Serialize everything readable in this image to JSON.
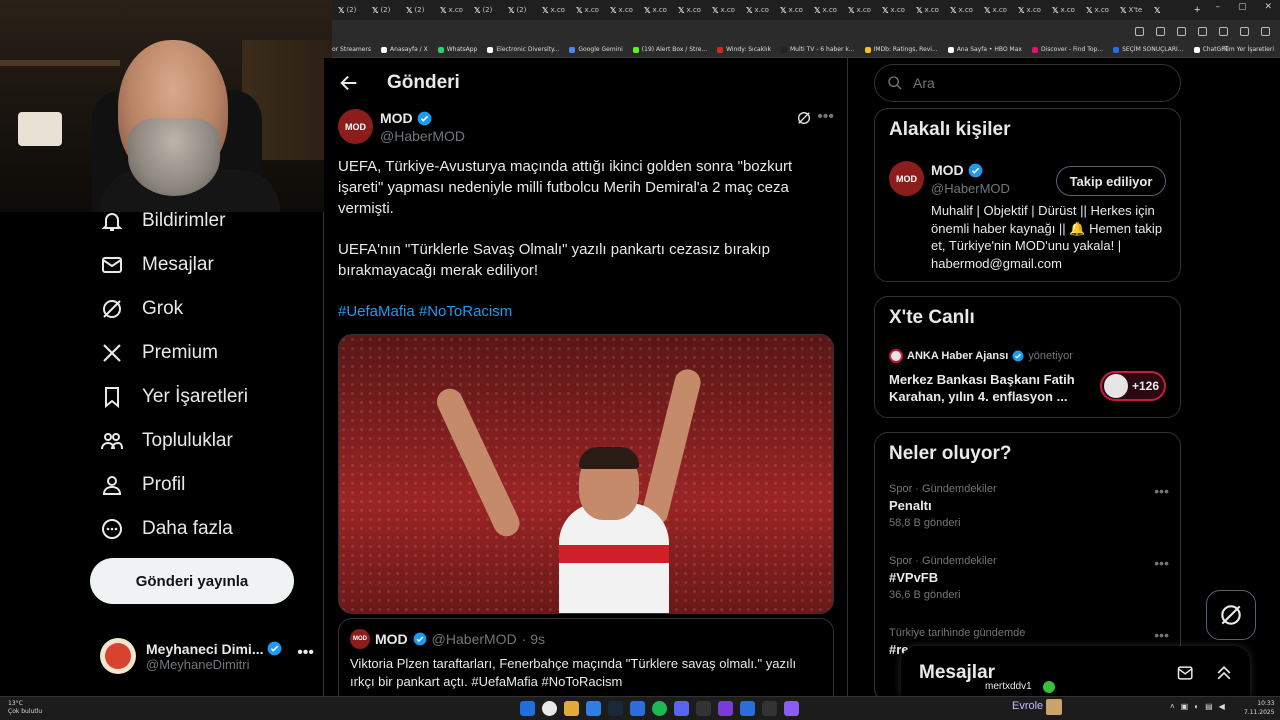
{
  "browser": {
    "tabs": [
      {
        "icon": "x-logo",
        "label": "(2)"
      },
      {
        "icon": "x-logo",
        "label": "(2)"
      },
      {
        "icon": "x-logo",
        "label": "(2)"
      },
      {
        "icon": "x-logo",
        "label": "x.co"
      },
      {
        "icon": "x-logo",
        "label": "(2)"
      },
      {
        "icon": "x-logo",
        "label": "(2)"
      },
      {
        "icon": "x-logo",
        "label": "x.co"
      },
      {
        "icon": "x-logo",
        "label": "x.co"
      },
      {
        "icon": "x-logo",
        "label": "x.co"
      },
      {
        "icon": "x-logo",
        "label": "x.co"
      },
      {
        "icon": "x-logo",
        "label": "x.co"
      },
      {
        "icon": "x-logo",
        "label": "x.co"
      },
      {
        "icon": "x-logo",
        "label": "x.co"
      },
      {
        "icon": "x-logo",
        "label": "x.co"
      },
      {
        "icon": "x-logo",
        "label": "x.co"
      },
      {
        "icon": "x-logo",
        "label": "x.co"
      },
      {
        "icon": "x-logo",
        "label": "x.co"
      },
      {
        "icon": "x-logo",
        "label": "x.co"
      },
      {
        "icon": "x-logo",
        "label": "x.co"
      },
      {
        "icon": "x-logo",
        "label": "x.co"
      },
      {
        "icon": "x-logo",
        "label": "x.co"
      },
      {
        "icon": "x-logo",
        "label": "x.co"
      },
      {
        "icon": "x-logo",
        "label": "x.co"
      },
      {
        "icon": "x-logo",
        "label": "X'te"
      },
      {
        "icon": "x-logo",
        "label": ""
      }
    ],
    "bookmarks": [
      {
        "label": "or Streamers",
        "color": ""
      },
      {
        "label": "Anasayfa / X",
        "color": "#ffffff"
      },
      {
        "label": "WhatsApp",
        "color": "#25d366"
      },
      {
        "label": "Electronic Diversity...",
        "color": "#ffffff"
      },
      {
        "label": "Google Gemini",
        "color": "#4f86f7"
      },
      {
        "label": "(19) Alert Box / Stre...",
        "color": "#53fc18"
      },
      {
        "label": "Windy: Sıcaklık",
        "color": "#d22"
      },
      {
        "label": "Multi TV - 6 haber k...",
        "color": "#222"
      },
      {
        "label": "IMDb: Ratings, Revi...",
        "color": "#f5c518"
      },
      {
        "label": "Ana Sayfa • HBO Max",
        "color": "#ffffff"
      },
      {
        "label": "Discover - Find Top...",
        "color": "#e3106c"
      },
      {
        "label": "SEÇİM SONUÇLARI...",
        "color": "#1a73e8"
      },
      {
        "label": "ChatGPT",
        "color": "#ffffff"
      }
    ],
    "all_bookmarks": "Tüm Yer İşaretleri"
  },
  "nav": {
    "items": [
      {
        "icon": "bell-icon",
        "label": "Bildirimler"
      },
      {
        "icon": "mail-icon",
        "label": "Mesajlar"
      },
      {
        "icon": "grok-icon",
        "label": "Grok"
      },
      {
        "icon": "x-logo-icon",
        "label": "Premium"
      },
      {
        "icon": "bookmark-icon",
        "label": "Yer İşaretleri"
      },
      {
        "icon": "communities-icon",
        "label": "Topluluklar"
      },
      {
        "icon": "profile-icon",
        "label": "Profil"
      },
      {
        "icon": "more-circle-icon",
        "label": "Daha fazla"
      }
    ],
    "post_button": "Gönderi yayınla",
    "account": {
      "name": "Meyhaneci Dimi...",
      "handle": "@MeyhaneDimitri"
    }
  },
  "main": {
    "title": "Gönderi",
    "post": {
      "avatar_text": "MOD",
      "name": "MOD",
      "handle": "@HaberMOD",
      "paragraph1": "UEFA, Türkiye-Avusturya maçında attığı ikinci golden sonra \"bozkurt işareti\" yapması nedeniyle milli futbolcu Merih Demiral'a 2 maç ceza vermişti.",
      "paragraph2": "UEFA'nın \"Türklerle Savaş Olmalı\" yazılı pankartı cezasız bırakıp bırakmayacağı merak ediliyor!",
      "hashtags": "#UefaMafia #NoToRacism"
    },
    "quote": {
      "avatar_text": "MOD",
      "name": "MOD",
      "handle": "@HaberMOD",
      "time": "· 9s",
      "text": "Viktoria Plzen taraftarları, Fenerbahçe maçında \"Türklere savaş olmalı.\" yazılı ırkçı bir pankart açtı. #UefaMafia #NoToRacism"
    }
  },
  "right": {
    "search_placeholder": "Ara",
    "related": {
      "title": "Alakalı kişiler",
      "avatar_text": "MOD",
      "name": "MOD",
      "handle": "@HaberMOD",
      "follow_label": "Takip ediliyor",
      "bio": "Muhalif | Objektif | Dürüst || Herkes için önemli haber kaynağı || 🔔 Hemen takip et, Türkiye'nin MOD'unu yakala! | habermod@gmail.com"
    },
    "live": {
      "title": "X'te Canlı",
      "source": "ANKA Haber Ajansı",
      "source_tag": "yönetiyor",
      "text": "Merkez Bankası Başkanı Fatih Karahan, yılın 4. enflasyon ...",
      "count": "+126"
    },
    "trends": {
      "title": "Neler oluyor?",
      "items": [
        {
          "meta": "Spor · Gündemdekiler",
          "name": "Penaltı",
          "count": "58,8 B gönderi"
        },
        {
          "meta": "Spor · Gündemdekiler",
          "name": "#VPvFB",
          "count": "36,6 B gönderi"
        },
        {
          "meta": "Türkiye tarihinde gündemde",
          "name": "#re",
          "count": ""
        }
      ]
    },
    "messages_title": "Mesajlar"
  },
  "overlay": {
    "chat_user": "mertxddv1"
  },
  "taskbar": {
    "weather_temp": "13°C",
    "weather_desc": "Çok bulutlu",
    "user": "Evrole",
    "time": "10:33",
    "date": "7.11.2025"
  }
}
